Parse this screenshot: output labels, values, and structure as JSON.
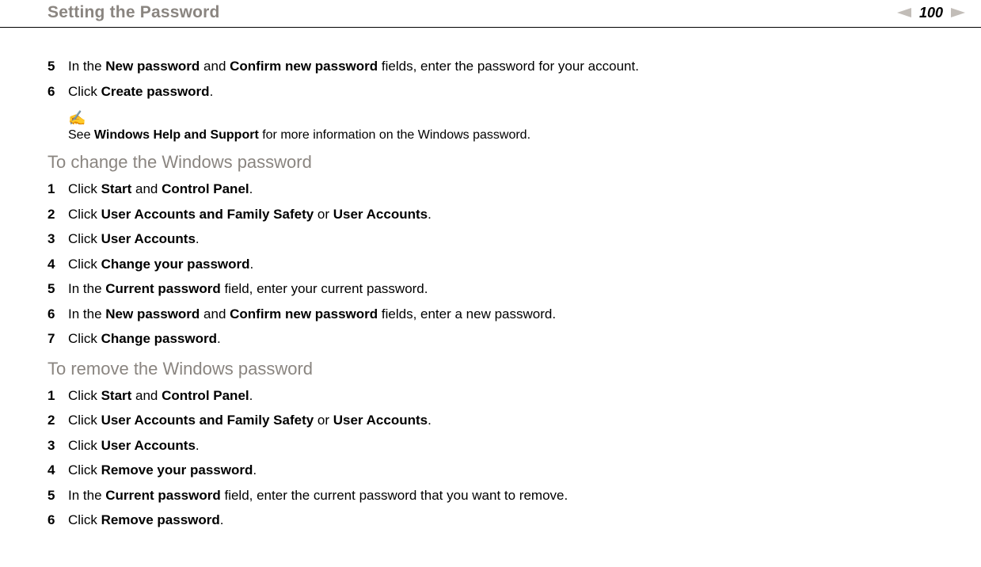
{
  "header": {
    "title": "Setting the Password",
    "page_number": "100"
  },
  "top_steps": {
    "s5": {
      "num": "5",
      "p1": "In the ",
      "b1": "New password",
      "p2": " and ",
      "b2": "Confirm new password",
      "p3": " fields, enter the password for your account."
    },
    "s6": {
      "num": "6",
      "p1": "Click ",
      "b1": "Create password",
      "p2": "."
    }
  },
  "note": {
    "icon": "✍",
    "p1": "See ",
    "b1": "Windows Help and Support",
    "p2": " for more information on the Windows password."
  },
  "section_change": {
    "heading": "To change the Windows password",
    "s1": {
      "num": "1",
      "p1": "Click ",
      "b1": "Start",
      "p2": " and ",
      "b2": "Control Panel",
      "p3": "."
    },
    "s2": {
      "num": "2",
      "p1": "Click ",
      "b1": "User Accounts and Family Safety",
      "p2": " or ",
      "b2": "User Accounts",
      "p3": "."
    },
    "s3": {
      "num": "3",
      "p1": "Click ",
      "b1": "User Accounts",
      "p2": "."
    },
    "s4": {
      "num": "4",
      "p1": "Click ",
      "b1": "Change your password",
      "p2": "."
    },
    "s5": {
      "num": "5",
      "p1": "In the ",
      "b1": "Current password",
      "p2": " field, enter your current password."
    },
    "s6": {
      "num": "6",
      "p1": "In the ",
      "b1": "New password",
      "p2": " and ",
      "b2": "Confirm new password",
      "p3": " fields, enter a new password."
    },
    "s7": {
      "num": "7",
      "p1": "Click ",
      "b1": "Change password",
      "p2": "."
    }
  },
  "section_remove": {
    "heading": "To remove the Windows password",
    "s1": {
      "num": "1",
      "p1": "Click ",
      "b1": "Start",
      "p2": " and ",
      "b2": "Control Panel",
      "p3": "."
    },
    "s2": {
      "num": "2",
      "p1": "Click ",
      "b1": "User Accounts and Family Safety",
      "p2": " or ",
      "b2": "User Accounts",
      "p3": "."
    },
    "s3": {
      "num": "3",
      "p1": "Click ",
      "b1": "User Accounts",
      "p2": "."
    },
    "s4": {
      "num": "4",
      "p1": "Click ",
      "b1": "Remove your password",
      "p2": "."
    },
    "s5": {
      "num": "5",
      "p1": "In the ",
      "b1": "Current password",
      "p2": " field, enter the current password that you want to remove."
    },
    "s6": {
      "num": "6",
      "p1": "Click ",
      "b1": "Remove password",
      "p2": "."
    }
  }
}
